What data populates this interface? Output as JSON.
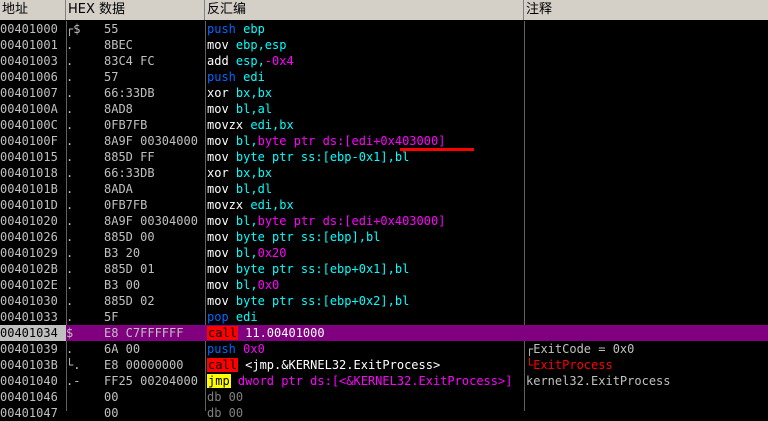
{
  "header": {
    "address": "地址",
    "hex": "HEX 数据",
    "disasm": "反汇编",
    "comment": "注释"
  },
  "colors": {
    "reg": "#00ffff",
    "num": "#ff00ff",
    "mnem": "#ffffff",
    "push_pop": "#0066ff",
    "mem": "#ff00ff"
  },
  "rows": [
    {
      "addr": "00401000",
      "mark": "┌$",
      "hex": "55",
      "dis": [
        {
          "t": "push",
          "c": "pp"
        },
        {
          "t": " ebp",
          "c": "reg"
        }
      ],
      "cmt": ""
    },
    {
      "addr": "00401001",
      "mark": ".",
      "hex": "8BEC",
      "dis": [
        {
          "t": "mov",
          "c": "m"
        },
        {
          "t": " ebp,esp",
          "c": "reg"
        }
      ],
      "cmt": ""
    },
    {
      "addr": "00401003",
      "mark": ".",
      "hex": "83C4 FC",
      "dis": [
        {
          "t": "add",
          "c": "m"
        },
        {
          "t": " esp,",
          "c": "reg"
        },
        {
          "t": "-0x4",
          "c": "num"
        }
      ],
      "cmt": ""
    },
    {
      "addr": "00401006",
      "mark": ".",
      "hex": "57",
      "dis": [
        {
          "t": "push",
          "c": "pp"
        },
        {
          "t": " edi",
          "c": "reg"
        }
      ],
      "cmt": ""
    },
    {
      "addr": "00401007",
      "mark": ".",
      "hex": "66:33DB",
      "dis": [
        {
          "t": "xor",
          "c": "m"
        },
        {
          "t": " bx,bx",
          "c": "reg"
        }
      ],
      "cmt": ""
    },
    {
      "addr": "0040100A",
      "mark": ".",
      "hex": "8AD8",
      "dis": [
        {
          "t": "mov",
          "c": "m"
        },
        {
          "t": " bl,al",
          "c": "reg"
        }
      ],
      "cmt": ""
    },
    {
      "addr": "0040100C",
      "mark": ".",
      "hex": "0FB7FB",
      "dis": [
        {
          "t": "movzx",
          "c": "m"
        },
        {
          "t": " edi,bx",
          "c": "reg"
        }
      ],
      "cmt": ""
    },
    {
      "addr": "0040100F",
      "mark": ".",
      "hex": "8A9F 00304000",
      "dis": [
        {
          "t": "mov",
          "c": "m"
        },
        {
          "t": " bl,",
          "c": "reg"
        },
        {
          "t": "byte ptr ds:[edi+0x403000]",
          "c": "mem"
        }
      ],
      "cmt": ""
    },
    {
      "addr": "00401015",
      "mark": ".",
      "hex": "885D FF",
      "dis": [
        {
          "t": "mov",
          "c": "m"
        },
        {
          "t": " byte ptr ss:[ebp-0x1],bl",
          "c": "reg"
        }
      ],
      "cmt": ""
    },
    {
      "addr": "00401018",
      "mark": ".",
      "hex": "66:33DB",
      "dis": [
        {
          "t": "xor",
          "c": "m"
        },
        {
          "t": " bx,bx",
          "c": "reg"
        }
      ],
      "cmt": ""
    },
    {
      "addr": "0040101B",
      "mark": ".",
      "hex": "8ADA",
      "dis": [
        {
          "t": "mov",
          "c": "m"
        },
        {
          "t": " bl,dl",
          "c": "reg"
        }
      ],
      "cmt": ""
    },
    {
      "addr": "0040101D",
      "mark": ".",
      "hex": "0FB7FB",
      "dis": [
        {
          "t": "movzx",
          "c": "m"
        },
        {
          "t": " edi,bx",
          "c": "reg"
        }
      ],
      "cmt": ""
    },
    {
      "addr": "00401020",
      "mark": ".",
      "hex": "8A9F 00304000",
      "dis": [
        {
          "t": "mov",
          "c": "m"
        },
        {
          "t": " bl,",
          "c": "reg"
        },
        {
          "t": "byte ptr ds:[edi+0x403000]",
          "c": "mem"
        }
      ],
      "cmt": ""
    },
    {
      "addr": "00401026",
      "mark": ".",
      "hex": "885D 00",
      "dis": [
        {
          "t": "mov",
          "c": "m"
        },
        {
          "t": " byte ptr ss:[ebp],bl",
          "c": "reg"
        }
      ],
      "cmt": ""
    },
    {
      "addr": "00401029",
      "mark": ".",
      "hex": "B3 20",
      "dis": [
        {
          "t": "mov",
          "c": "m"
        },
        {
          "t": " bl,",
          "c": "reg"
        },
        {
          "t": "0x20",
          "c": "num"
        }
      ],
      "cmt": ""
    },
    {
      "addr": "0040102B",
      "mark": ".",
      "hex": "885D 01",
      "dis": [
        {
          "t": "mov",
          "c": "m"
        },
        {
          "t": " byte ptr ss:[ebp+0x1],bl",
          "c": "reg"
        }
      ],
      "cmt": ""
    },
    {
      "addr": "0040102E",
      "mark": ".",
      "hex": "B3 00",
      "dis": [
        {
          "t": "mov",
          "c": "m"
        },
        {
          "t": " bl,",
          "c": "reg"
        },
        {
          "t": "0x0",
          "c": "num"
        }
      ],
      "cmt": ""
    },
    {
      "addr": "00401030",
      "mark": ".",
      "hex": "885D 02",
      "dis": [
        {
          "t": "mov",
          "c": "m"
        },
        {
          "t": " byte ptr ss:[ebp+0x2],bl",
          "c": "reg"
        }
      ],
      "cmt": ""
    },
    {
      "addr": "00401033",
      "mark": ".",
      "hex": "5F",
      "dis": [
        {
          "t": "pop",
          "c": "pp"
        },
        {
          "t": " edi",
          "c": "reg"
        }
      ],
      "cmt": ""
    },
    {
      "addr": "00401034",
      "mark": "$",
      "hex": "E8 C7FFFFFF",
      "dis": [
        {
          "t": "call",
          "c": "call"
        },
        {
          "t": " 11.00401000",
          "c": "m"
        }
      ],
      "cmt": "",
      "sel": true
    },
    {
      "addr": "00401039",
      "mark": ".",
      "hex": "6A 00",
      "dis": [
        {
          "t": "push",
          "c": "pp"
        },
        {
          "t": " 0x0",
          "c": "num"
        }
      ],
      "cmt": "┌ExitCode = 0x0",
      "cmtc": "#c0c0c0"
    },
    {
      "addr": "0040103B",
      "mark": "└.",
      "hex": "E8 00000000",
      "dis": [
        {
          "t": "call",
          "c": "call"
        },
        {
          "t": " <jmp.&KERNEL32.ExitProcess>",
          "c": "m"
        }
      ],
      "cmt": "└ExitProcess",
      "cmtc": "#ff0000"
    },
    {
      "addr": "00401040",
      "mark": ".-",
      "hex": "FF25 00204000",
      "dis": [
        {
          "t": "jmp",
          "c": "jmp"
        },
        {
          "t": " dword ptr ds:[<&KERNEL32.ExitProcess>]",
          "c": "mem"
        }
      ],
      "cmt": "kernel32.ExitProcess",
      "cmtc": "#c0c0c0"
    },
    {
      "addr": "00401046",
      "mark": "",
      "hex": "00",
      "dis": [
        {
          "t": "db 00",
          "c": "dim"
        }
      ],
      "cmt": ""
    },
    {
      "addr": "00401047",
      "mark": "",
      "hex": "00",
      "dis": [
        {
          "t": "db 00",
          "c": "dim"
        }
      ],
      "cmt": ""
    }
  ]
}
